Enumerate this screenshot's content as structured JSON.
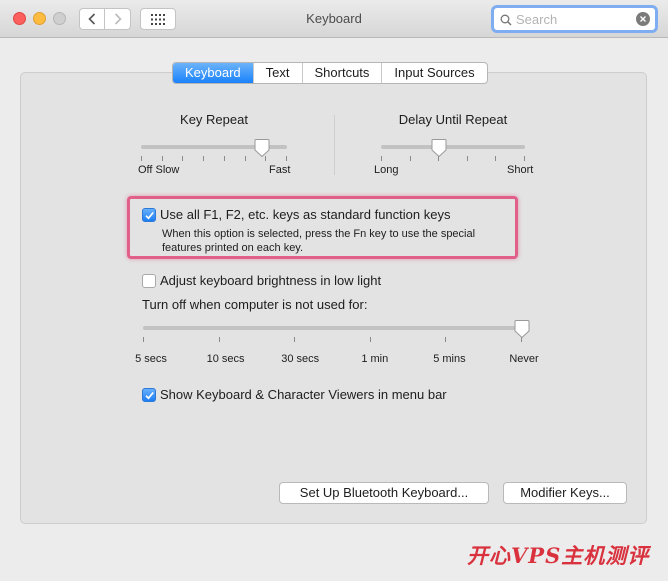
{
  "window": {
    "title": "Keyboard"
  },
  "search": {
    "placeholder": "Search",
    "value": ""
  },
  "tabs": [
    {
      "label": "Keyboard",
      "active": true
    },
    {
      "label": "Text",
      "active": false
    },
    {
      "label": "Shortcuts",
      "active": false
    },
    {
      "label": "Input Sources",
      "active": false
    }
  ],
  "key_repeat": {
    "title": "Key Repeat",
    "min_label": "Off Slow",
    "max_label": "Fast",
    "level": 0.83,
    "ticks": 8
  },
  "delay_until_repeat": {
    "title": "Delay Until Repeat",
    "min_label": "Long",
    "max_label": "Short",
    "level": 0.4,
    "ticks": 6
  },
  "fn_keys": {
    "checked": true,
    "label": "Use all F1, F2, etc. keys as standard function keys",
    "description": "When this option is selected, press the Fn key to use the special features printed on each key."
  },
  "brightness": {
    "checked": false,
    "label": "Adjust keyboard brightness in low light"
  },
  "idle": {
    "label": "Turn off when computer is not used for:",
    "options": [
      "5 secs",
      "10 secs",
      "30 secs",
      "1 min",
      "5 mins",
      "Never"
    ],
    "selected": "Never"
  },
  "viewers": {
    "checked": true,
    "label": "Show Keyboard & Character Viewers in menu bar"
  },
  "buttons": {
    "bluetooth": "Set Up Bluetooth Keyboard...",
    "modifier": "Modifier Keys..."
  },
  "watermark": "开心VPS主机测评",
  "colors": {
    "accent": "#1a82fb",
    "highlight": "#e0608a"
  }
}
